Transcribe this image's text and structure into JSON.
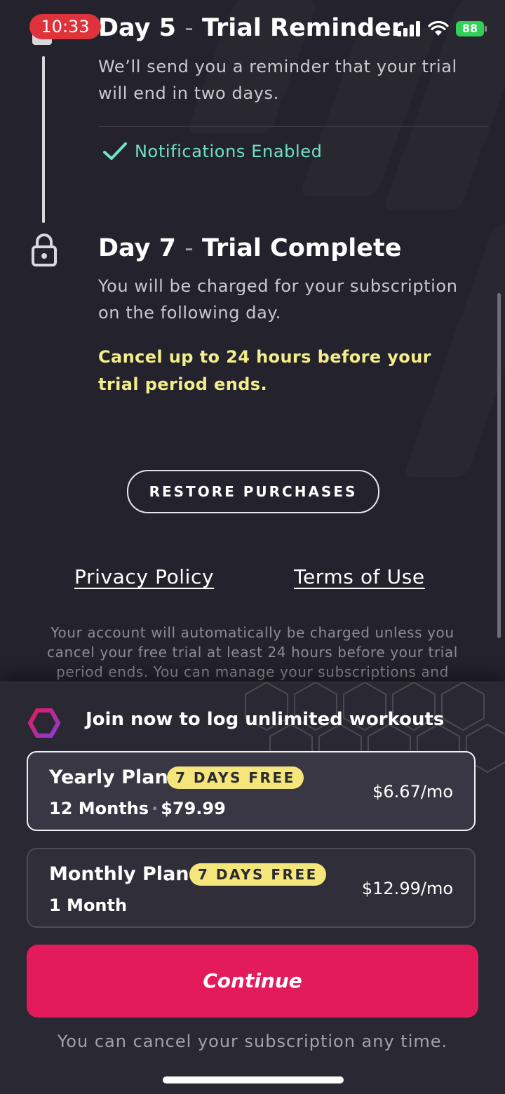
{
  "status_bar": {
    "time": "10:33",
    "battery": "88"
  },
  "timeline": {
    "step5": {
      "title_prefix": "Day 5",
      "title_suffix": "Trial Reminder",
      "description": "We’ll send you a reminder that your trial will end in two days.",
      "notification_label": "Notifications Enabled"
    },
    "step7": {
      "title_prefix": "Day 7",
      "title_suffix": "Trial Complete",
      "description": "You will be charged for your subscription on the following day.",
      "cancel_note": "Cancel up to 24 hours before your trial period ends."
    }
  },
  "restore_label": "RESTORE PURCHASES",
  "links": {
    "privacy": "Privacy Policy",
    "terms": "Terms of Use"
  },
  "disclaimer": "Your account will automatically be charged unless you cancel your free trial at least 24 hours before your trial period ends. You can manage your subscriptions and",
  "sheet": {
    "title": "Join now to log unlimited workouts",
    "plans": [
      {
        "name": "Yearly Plan",
        "badge": "7 DAYS FREE",
        "term": "12 Months",
        "total": "$79.99",
        "price": "$6.67/mo",
        "selected": true
      },
      {
        "name": "Monthly Plan",
        "badge": "7 DAYS FREE",
        "term": "1 Month",
        "price": "$12.99/mo",
        "selected": false
      }
    ],
    "continue_label": "Continue",
    "cancel_anytime": "You can cancel your subscription any time."
  },
  "colors": {
    "background": "#24232d",
    "accent_pink": "#e41b5a",
    "badge_yellow": "#f4e67a",
    "notif_green": "#6fe3c2",
    "warning_yellow": "#f4ee8a"
  },
  "icons": [
    "check-icon",
    "lock-icon",
    "brand-hexagon-icon",
    "signal-icon",
    "wifi-icon",
    "battery-icon"
  ]
}
